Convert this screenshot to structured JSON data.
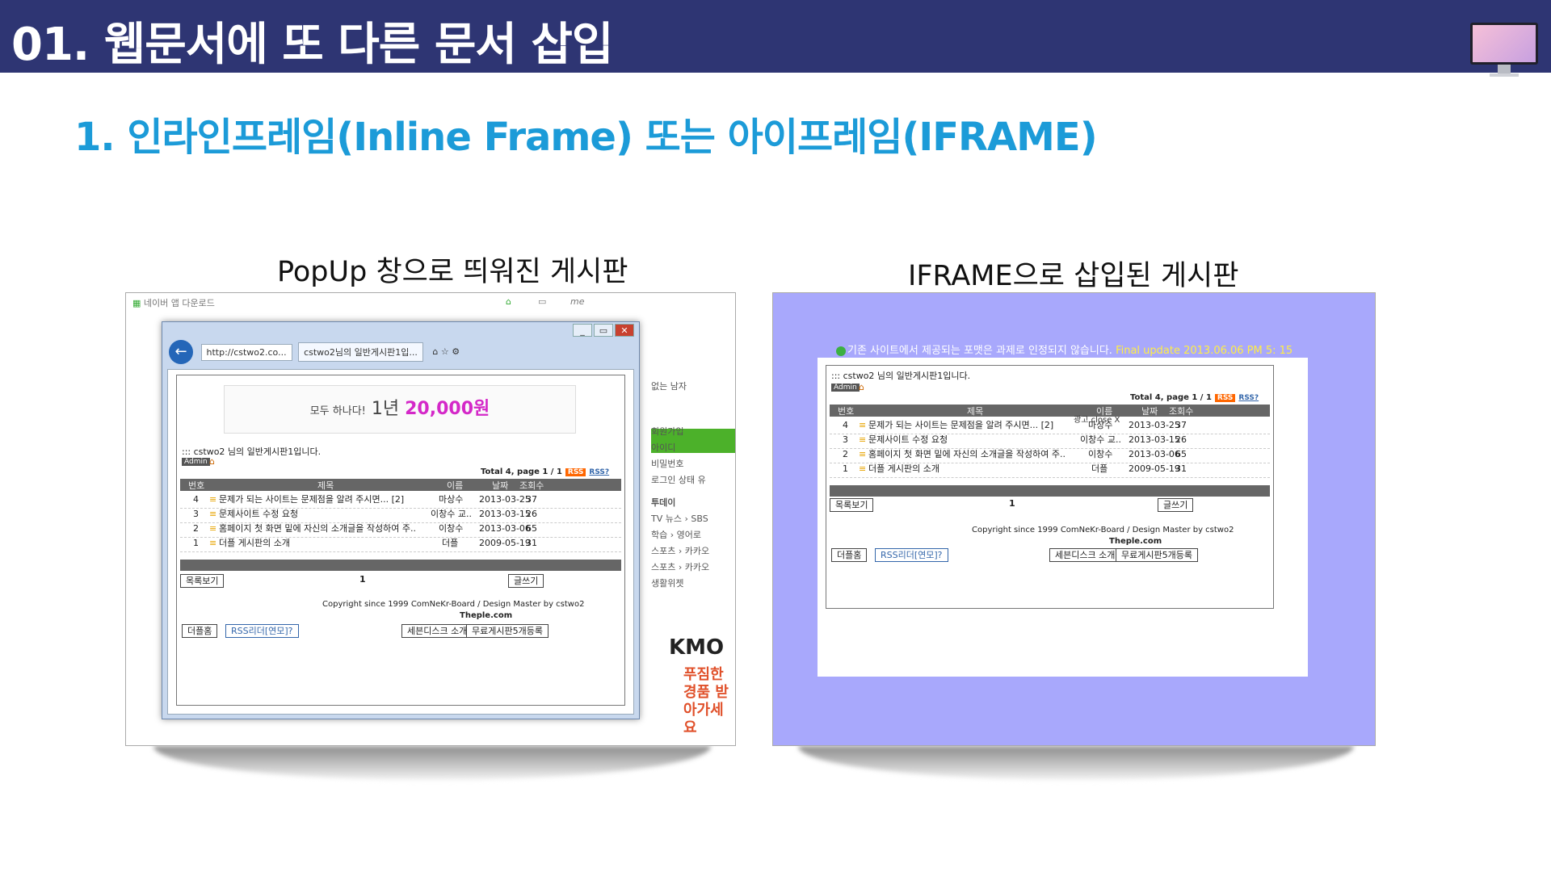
{
  "header": {
    "title": "01. 웹문서에 또 다른 문서 삽입"
  },
  "subtitle": "1. 인라인프레임(Inline Frame) 또는 아이프레임(IFRAME)",
  "captions": {
    "left": "PopUp 창으로 띄워진 게시판",
    "right": "IFRAME으로 삽입된 게시판"
  },
  "popup": {
    "bg_top": "네이버 앱 다운로드",
    "bg_side": [
      "없는 남자",
      "회원가입",
      "아이디",
      "비밀번호",
      "로그인 상태 유",
      "투데이",
      "TV 뉴스 › SBS",
      "학습 › 영어로",
      "스포츠 › 카카오",
      "스포츠 › 카카오",
      "생활위젯"
    ],
    "kmo_logo": "KMO",
    "kmo_text": "푸짐한 경품 받아가세요",
    "url": "http://cstwo2.co...",
    "tab_title": "cstwo2님의 일반게시판1입...",
    "banner_prefix": "모두 하나다!",
    "banner_year": "1년",
    "banner_price": "20,000원"
  },
  "board": {
    "title": "::: cstwo2 님의 일반게시판1입니다.",
    "admin": "Admin",
    "total": "Total 4, page 1 / 1",
    "rss": "RSS",
    "rss2": "RSS?",
    "columns": [
      "번호",
      "제목",
      "이름",
      "날짜",
      "조회수"
    ],
    "rows": [
      {
        "no": "4",
        "title": "문제가 되는 사이트는 문제점을 알려 주시면... [2]",
        "name": "마상수",
        "date": "2013-03-25",
        "views": "37"
      },
      {
        "no": "3",
        "title": "문제사이트 수정 요청",
        "name": "이창수 교..",
        "date": "2013-03-15",
        "views": "26"
      },
      {
        "no": "2",
        "title": "홈페이지 첫 화면 밑에 자신의 소개글을 작성하여 주..",
        "name": "이창수",
        "date": "2013-03-06",
        "views": "65"
      },
      {
        "no": "1",
        "title": "더플 게시판의 소개",
        "name": "더플",
        "date": "2009-05-19",
        "views": "31"
      }
    ],
    "list_button": "목록보기",
    "page": "1",
    "write_button": "글쓰기",
    "copyright": "Copyright since 1999 ComNeKr-Board / Design Master by cstwo2",
    "site": "Theple.com",
    "home_button": "더플홈",
    "rss_button": "RSS리더[연모]?",
    "disk_button": "세븐디스크 소개",
    "free_button": "무료게시판5개등록"
  },
  "iframe_panel": {
    "note": "기존 사이트에서 제공되는 포맷은 과제로 인정되지 않습니다.",
    "update": "Final update 2013.06.06 PM 5: 15",
    "ad": "광고",
    "close": "close X"
  }
}
